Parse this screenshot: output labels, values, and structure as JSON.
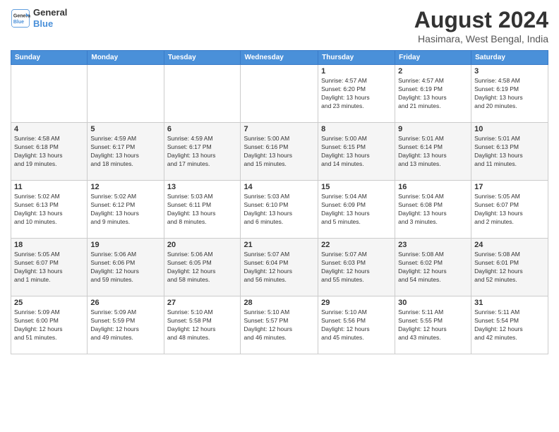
{
  "logo": {
    "line1": "General",
    "line2": "Blue"
  },
  "header": {
    "month": "August 2024",
    "location": "Hasimara, West Bengal, India"
  },
  "weekdays": [
    "Sunday",
    "Monday",
    "Tuesday",
    "Wednesday",
    "Thursday",
    "Friday",
    "Saturday"
  ],
  "weeks": [
    [
      {
        "day": "",
        "info": ""
      },
      {
        "day": "",
        "info": ""
      },
      {
        "day": "",
        "info": ""
      },
      {
        "day": "",
        "info": ""
      },
      {
        "day": "1",
        "info": "Sunrise: 4:57 AM\nSunset: 6:20 PM\nDaylight: 13 hours\nand 23 minutes."
      },
      {
        "day": "2",
        "info": "Sunrise: 4:57 AM\nSunset: 6:19 PM\nDaylight: 13 hours\nand 21 minutes."
      },
      {
        "day": "3",
        "info": "Sunrise: 4:58 AM\nSunset: 6:19 PM\nDaylight: 13 hours\nand 20 minutes."
      }
    ],
    [
      {
        "day": "4",
        "info": "Sunrise: 4:58 AM\nSunset: 6:18 PM\nDaylight: 13 hours\nand 19 minutes."
      },
      {
        "day": "5",
        "info": "Sunrise: 4:59 AM\nSunset: 6:17 PM\nDaylight: 13 hours\nand 18 minutes."
      },
      {
        "day": "6",
        "info": "Sunrise: 4:59 AM\nSunset: 6:17 PM\nDaylight: 13 hours\nand 17 minutes."
      },
      {
        "day": "7",
        "info": "Sunrise: 5:00 AM\nSunset: 6:16 PM\nDaylight: 13 hours\nand 15 minutes."
      },
      {
        "day": "8",
        "info": "Sunrise: 5:00 AM\nSunset: 6:15 PM\nDaylight: 13 hours\nand 14 minutes."
      },
      {
        "day": "9",
        "info": "Sunrise: 5:01 AM\nSunset: 6:14 PM\nDaylight: 13 hours\nand 13 minutes."
      },
      {
        "day": "10",
        "info": "Sunrise: 5:01 AM\nSunset: 6:13 PM\nDaylight: 13 hours\nand 11 minutes."
      }
    ],
    [
      {
        "day": "11",
        "info": "Sunrise: 5:02 AM\nSunset: 6:13 PM\nDaylight: 13 hours\nand 10 minutes."
      },
      {
        "day": "12",
        "info": "Sunrise: 5:02 AM\nSunset: 6:12 PM\nDaylight: 13 hours\nand 9 minutes."
      },
      {
        "day": "13",
        "info": "Sunrise: 5:03 AM\nSunset: 6:11 PM\nDaylight: 13 hours\nand 8 minutes."
      },
      {
        "day": "14",
        "info": "Sunrise: 5:03 AM\nSunset: 6:10 PM\nDaylight: 13 hours\nand 6 minutes."
      },
      {
        "day": "15",
        "info": "Sunrise: 5:04 AM\nSunset: 6:09 PM\nDaylight: 13 hours\nand 5 minutes."
      },
      {
        "day": "16",
        "info": "Sunrise: 5:04 AM\nSunset: 6:08 PM\nDaylight: 13 hours\nand 3 minutes."
      },
      {
        "day": "17",
        "info": "Sunrise: 5:05 AM\nSunset: 6:07 PM\nDaylight: 13 hours\nand 2 minutes."
      }
    ],
    [
      {
        "day": "18",
        "info": "Sunrise: 5:05 AM\nSunset: 6:07 PM\nDaylight: 13 hours\nand 1 minute."
      },
      {
        "day": "19",
        "info": "Sunrise: 5:06 AM\nSunset: 6:06 PM\nDaylight: 12 hours\nand 59 minutes."
      },
      {
        "day": "20",
        "info": "Sunrise: 5:06 AM\nSunset: 6:05 PM\nDaylight: 12 hours\nand 58 minutes."
      },
      {
        "day": "21",
        "info": "Sunrise: 5:07 AM\nSunset: 6:04 PM\nDaylight: 12 hours\nand 56 minutes."
      },
      {
        "day": "22",
        "info": "Sunrise: 5:07 AM\nSunset: 6:03 PM\nDaylight: 12 hours\nand 55 minutes."
      },
      {
        "day": "23",
        "info": "Sunrise: 5:08 AM\nSunset: 6:02 PM\nDaylight: 12 hours\nand 54 minutes."
      },
      {
        "day": "24",
        "info": "Sunrise: 5:08 AM\nSunset: 6:01 PM\nDaylight: 12 hours\nand 52 minutes."
      }
    ],
    [
      {
        "day": "25",
        "info": "Sunrise: 5:09 AM\nSunset: 6:00 PM\nDaylight: 12 hours\nand 51 minutes."
      },
      {
        "day": "26",
        "info": "Sunrise: 5:09 AM\nSunset: 5:59 PM\nDaylight: 12 hours\nand 49 minutes."
      },
      {
        "day": "27",
        "info": "Sunrise: 5:10 AM\nSunset: 5:58 PM\nDaylight: 12 hours\nand 48 minutes."
      },
      {
        "day": "28",
        "info": "Sunrise: 5:10 AM\nSunset: 5:57 PM\nDaylight: 12 hours\nand 46 minutes."
      },
      {
        "day": "29",
        "info": "Sunrise: 5:10 AM\nSunset: 5:56 PM\nDaylight: 12 hours\nand 45 minutes."
      },
      {
        "day": "30",
        "info": "Sunrise: 5:11 AM\nSunset: 5:55 PM\nDaylight: 12 hours\nand 43 minutes."
      },
      {
        "day": "31",
        "info": "Sunrise: 5:11 AM\nSunset: 5:54 PM\nDaylight: 12 hours\nand 42 minutes."
      }
    ]
  ]
}
